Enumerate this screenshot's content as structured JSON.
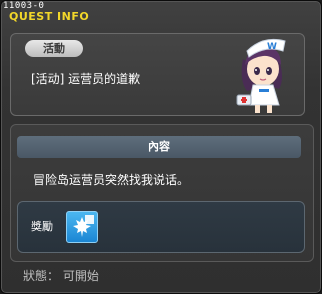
{
  "header": {
    "quest_code": "11003-0",
    "title": "QUEST INFO"
  },
  "quest": {
    "category_tag": "活動",
    "name": "[活动] 运营员的道歉"
  },
  "content": {
    "header": "內容",
    "text": "冒险岛运营员突然找我说话。"
  },
  "reward": {
    "label": "獎勵",
    "item_icon": "maple-leaf-icon"
  },
  "status": {
    "text": "狀態： 可開始"
  },
  "colors": {
    "title": "#f2d72a",
    "content_header": "#5e6e7c",
    "reward_icon": "#2a9ce6"
  }
}
